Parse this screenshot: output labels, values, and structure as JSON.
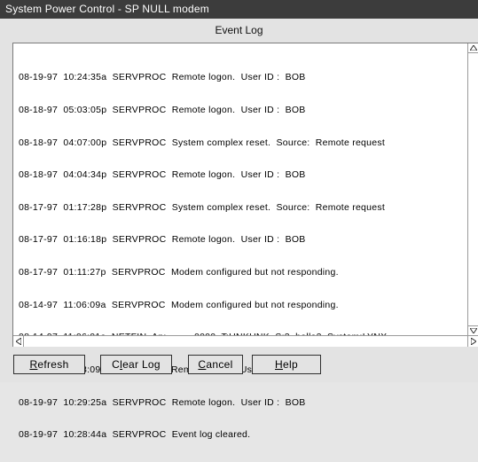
{
  "window": {
    "title": "System Power Control - SP NULL modem"
  },
  "dialog": {
    "heading": "Event Log"
  },
  "log": {
    "lines": [
      "08-19-97  10:24:35a  SERVPROC  Remote logon.  User ID :  BOB",
      "08-18-97  05:03:05p  SERVPROC  Remote logon.  User ID :  BOB",
      "08-18-97  04:07:00p  SERVPROC  System complex reset.  Source:  Remote request",
      "08-18-97  04:04:34p  SERVPROC  Remote logon.  User ID :  BOB",
      "08-17-97  01:17:28p  SERVPROC  System complex reset.  Source:  Remote request",
      "08-17-97  01:16:18p  SERVPROC  Remote logon.  User ID :  BOB",
      "08-17-97  01:11:27p  SERVPROC  Modem configured but not responding.",
      "08-14-97  11:06:09a  SERVPROC  Modem configured but not responding.",
      "08-14-97  11:06:01a  NETFIN  Ap:        _0000  T:UNKUNK  S:3  hello2  System:LYNX",
      "08-14-97  11:03:09a  SERVPROC  Remote logon.  User ID :  BOB",
      "08-19-97  10:29:25a  SERVPROC  Remote logon.  User ID :  BOB",
      "08-19-97  10:28:44a  SERVPROC  Event log cleared."
    ]
  },
  "scrollbars": {
    "up_icon": "triangle-up-icon",
    "down_icon": "triangle-down-icon",
    "left_icon": "triangle-left-icon",
    "right_icon": "triangle-right-icon"
  },
  "buttons": {
    "refresh": {
      "mnemonic": "R",
      "rest": "efresh"
    },
    "clear_log": {
      "pre": "C",
      "mnemonic": "l",
      "rest": "ear Log"
    },
    "cancel": {
      "mnemonic": "C",
      "rest": "ancel"
    },
    "help": {
      "mnemonic": "H",
      "rest": "elp"
    }
  },
  "colors": {
    "titlebar": "#3c3c3c",
    "window_bg": "#e3e3e3",
    "panel_bg": "#ffffff"
  }
}
